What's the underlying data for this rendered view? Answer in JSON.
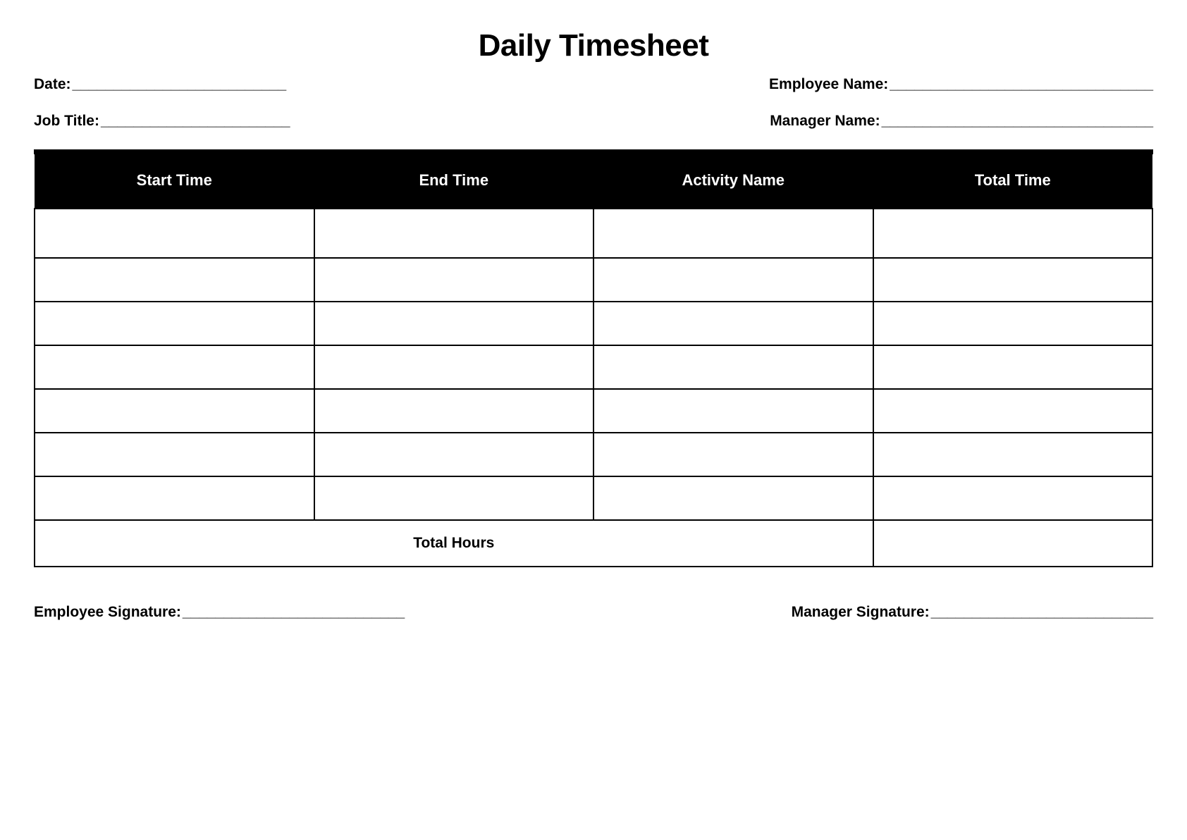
{
  "title": "Daily Timesheet",
  "fields": {
    "date_label": "Date:",
    "date_line": " __________________________",
    "employee_name_label": "Employee Name:",
    "employee_name_line": " ________________________________",
    "job_title_label": "Job Title:",
    "job_title_line": "_______________________",
    "manager_name_label": "Manager Name:",
    "manager_name_line": " _________________________________"
  },
  "table": {
    "headers": {
      "start_time": "Start Time",
      "end_time": "End Time",
      "activity_name": "Activity Name",
      "total_time": "Total Time"
    },
    "rows": [
      {
        "start": "",
        "end": "",
        "activity": "",
        "total": ""
      },
      {
        "start": "",
        "end": "",
        "activity": "",
        "total": ""
      },
      {
        "start": "",
        "end": "",
        "activity": "",
        "total": ""
      },
      {
        "start": "",
        "end": "",
        "activity": "",
        "total": ""
      },
      {
        "start": "",
        "end": "",
        "activity": "",
        "total": ""
      },
      {
        "start": "",
        "end": "",
        "activity": "",
        "total": ""
      },
      {
        "start": "",
        "end": "",
        "activity": "",
        "total": ""
      }
    ],
    "total_hours_label": "Total Hours",
    "total_hours_value": ""
  },
  "signatures": {
    "employee_label": "Employee Signature:",
    "employee_line": "___________________________",
    "manager_label": "Manager Signature:",
    "manager_line": "___________________________"
  }
}
